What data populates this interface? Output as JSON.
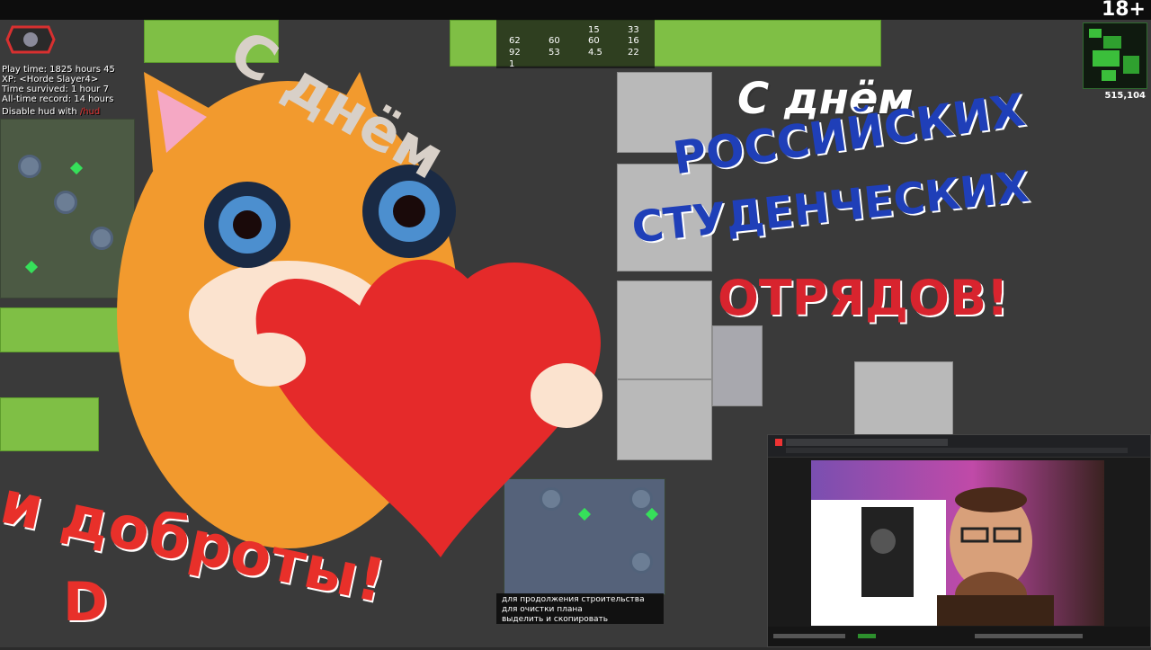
{
  "top_bar": {
    "age_rating": "18+"
  },
  "hud": {
    "lines": [
      "Play time: 1825 hours 45",
      "XP: <Horde Slayer4>",
      "Time survived: 1 hour 7",
      "All-time record: 14 hours",
      "Disable hud with"
    ],
    "hotkey": "/hud"
  },
  "resources": {
    "row1": [
      "62",
      "60",
      "15",
      "33"
    ],
    "row2": [
      "92",
      "53",
      "4.5",
      "22"
    ],
    "row0": [
      "62",
      "60",
      "60",
      "16"
    ],
    "extra": [
      "1",
      "4.5"
    ]
  },
  "minimap": {
    "count": "515,104"
  },
  "greeting_left": {
    "line1": "С днём",
    "line2": "и доброты!",
    "letter": "D"
  },
  "greeting_right": {
    "line1": "С днём",
    "line2": "российских",
    "line3": "студенческих",
    "line4": "отрядов!"
  },
  "tooltip": {
    "lines": [
      "для продолжения строительства",
      "для очистки плана",
      "выделить и скопировать"
    ]
  },
  "colors": {
    "grass": "#7fbf45",
    "belt_green": "#36e05a",
    "flag_blue": "#1f3fb8",
    "flag_red": "#d8242e",
    "heart_red": "#e52a2a",
    "cat_orange": "#f29a2e"
  }
}
